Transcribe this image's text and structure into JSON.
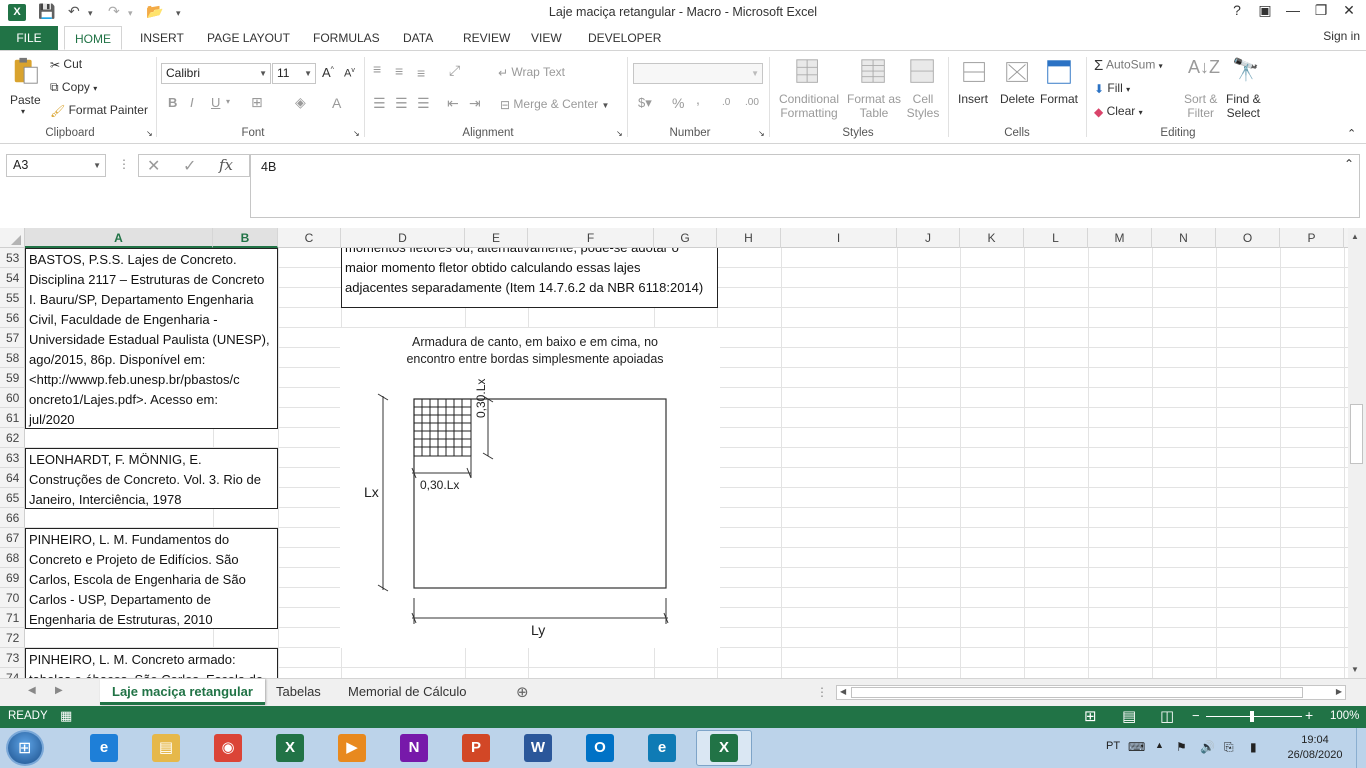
{
  "window": {
    "title": "Laje maciça retangular - Macro - Microsoft Excel",
    "app_logo": "X",
    "help": "?",
    "controls": [
      "—",
      "❐",
      "✕"
    ]
  },
  "tabs": {
    "file": "FILE",
    "items": [
      "HOME",
      "INSERT",
      "PAGE LAYOUT",
      "FORMULAS",
      "DATA",
      "REVIEW",
      "VIEW",
      "DEVELOPER"
    ],
    "active": "HOME",
    "signin": "Sign in"
  },
  "ribbon": {
    "clipboard": {
      "label": "Clipboard",
      "paste": "Paste",
      "cut": "Cut",
      "copy": "Copy",
      "format_painter": "Format Painter"
    },
    "font": {
      "label": "Font",
      "name": "Calibri",
      "size": "11",
      "bold": "B",
      "italic": "I",
      "underline": "U"
    },
    "alignment": {
      "label": "Alignment",
      "wrap": "Wrap Text",
      "merge": "Merge & Center"
    },
    "number": {
      "label": "Number",
      "format": "",
      "percent": "%",
      "comma": ","
    },
    "styles": {
      "label": "Styles",
      "cond1": "Conditional",
      "cond2": "Formatting",
      "fmt1": "Format as",
      "fmt2": "Table",
      "cell1": "Cell",
      "cell2": "Styles"
    },
    "cells": {
      "label": "Cells",
      "insert": "Insert",
      "delete": "Delete",
      "format": "Format"
    },
    "editing": {
      "label": "Editing",
      "autosum": "AutoSum",
      "fill": "Fill",
      "clear": "Clear",
      "sort1": "Sort &",
      "sort2": "Filter",
      "find1": "Find &",
      "find2": "Select"
    }
  },
  "formula_bar": {
    "name_box": "A3",
    "fx": "fx",
    "value": "4B"
  },
  "columns": [
    "A",
    "B",
    "C",
    "D",
    "E",
    "F",
    "G",
    "H",
    "I",
    "J",
    "K",
    "L",
    "M",
    "N",
    "O",
    "P"
  ],
  "rows": [
    "53",
    "54",
    "55",
    "56",
    "57",
    "58",
    "59",
    "60",
    "61",
    "62",
    "63",
    "64",
    "65",
    "66",
    "67",
    "68",
    "69",
    "70",
    "71",
    "72",
    "73",
    "74"
  ],
  "references": [
    {
      "lines": [
        "BASTOS, P.S.S. Lajes de Concreto.",
        "Disciplina 2117 – Estruturas de Concreto",
        "I. Bauru/SP, Departamento Engenharia",
        "Civil, Faculdade de Engenharia -",
        "Universidade Estadual Paulista (UNESP),",
        "ago/2015, 86p. Disponível em:",
        "<http://wwwp.feb.unesp.br/pbastos/c",
        "oncreto1/Lajes.pdf>. Acesso em:",
        "jul/2020"
      ]
    },
    {
      "lines": [
        "LEONHARDT, F. MÖNNIG, E.",
        "Construções de Concreto. Vol. 3. Rio de",
        "Janeiro, Interciência, 1978"
      ]
    },
    {
      "lines": [
        "PINHEIRO, L. M. Fundamentos do",
        "Concreto e Projeto de Edifícios. São",
        "Carlos, Escola de Engenharia de São",
        "Carlos - USP, Departamento de",
        "Engenharia de Estruturas, 2010"
      ]
    },
    {
      "lines": [
        "PINHEIRO, L. M. Concreto armado:",
        "tabelas e ábacos. São Carlos, Escola de"
      ]
    }
  ],
  "note": {
    "lines": [
      "momentos fletores ou, alternativamente, pode-se adotar o",
      "maior momento fletor obtido calculando essas lajes",
      "adjacentes separadamente (Item 14.7.6.2 da NBR 6118:2014)"
    ]
  },
  "diagram": {
    "caption1": "Armadura de canto, em baixo e em cima, no",
    "caption2": "encontro entre bordas simplesmente apoiadas",
    "dim_lx": "Lx",
    "dim_ly": "Ly",
    "dim_corner_h": "0,30.Lx",
    "dim_corner_v": "0,30.Lx"
  },
  "sheets": {
    "items": [
      "Laje maciça retangular",
      "Tabelas",
      "Memorial de Cálculo"
    ],
    "active": "Laje maciça retangular"
  },
  "status": {
    "ready": "READY",
    "zoom": "100%"
  },
  "taskbar": {
    "apps": [
      {
        "name": "ie-icon",
        "glyph": "e",
        "color": "#1e7fd8"
      },
      {
        "name": "explorer-icon",
        "glyph": "▤",
        "color": "#e6b84a"
      },
      {
        "name": "chrome-icon",
        "glyph": "◉",
        "color": "#db4437"
      },
      {
        "name": "excel-icon",
        "glyph": "X",
        "color": "#217346"
      },
      {
        "name": "media-icon",
        "glyph": "▶",
        "color": "#e8891e"
      },
      {
        "name": "onenote-icon",
        "glyph": "N",
        "color": "#7719aa"
      },
      {
        "name": "powerpoint-icon",
        "glyph": "P",
        "color": "#d24726"
      },
      {
        "name": "word-icon",
        "glyph": "W",
        "color": "#2b579a"
      },
      {
        "name": "outlook-icon",
        "glyph": "O",
        "color": "#0072c6"
      },
      {
        "name": "edge-icon",
        "glyph": "e",
        "color": "#0f7bb5"
      },
      {
        "name": "excel-active-icon",
        "glyph": "X",
        "color": "#217346"
      }
    ],
    "lang": "PT",
    "time": "19:04",
    "date": "26/08/2020"
  }
}
